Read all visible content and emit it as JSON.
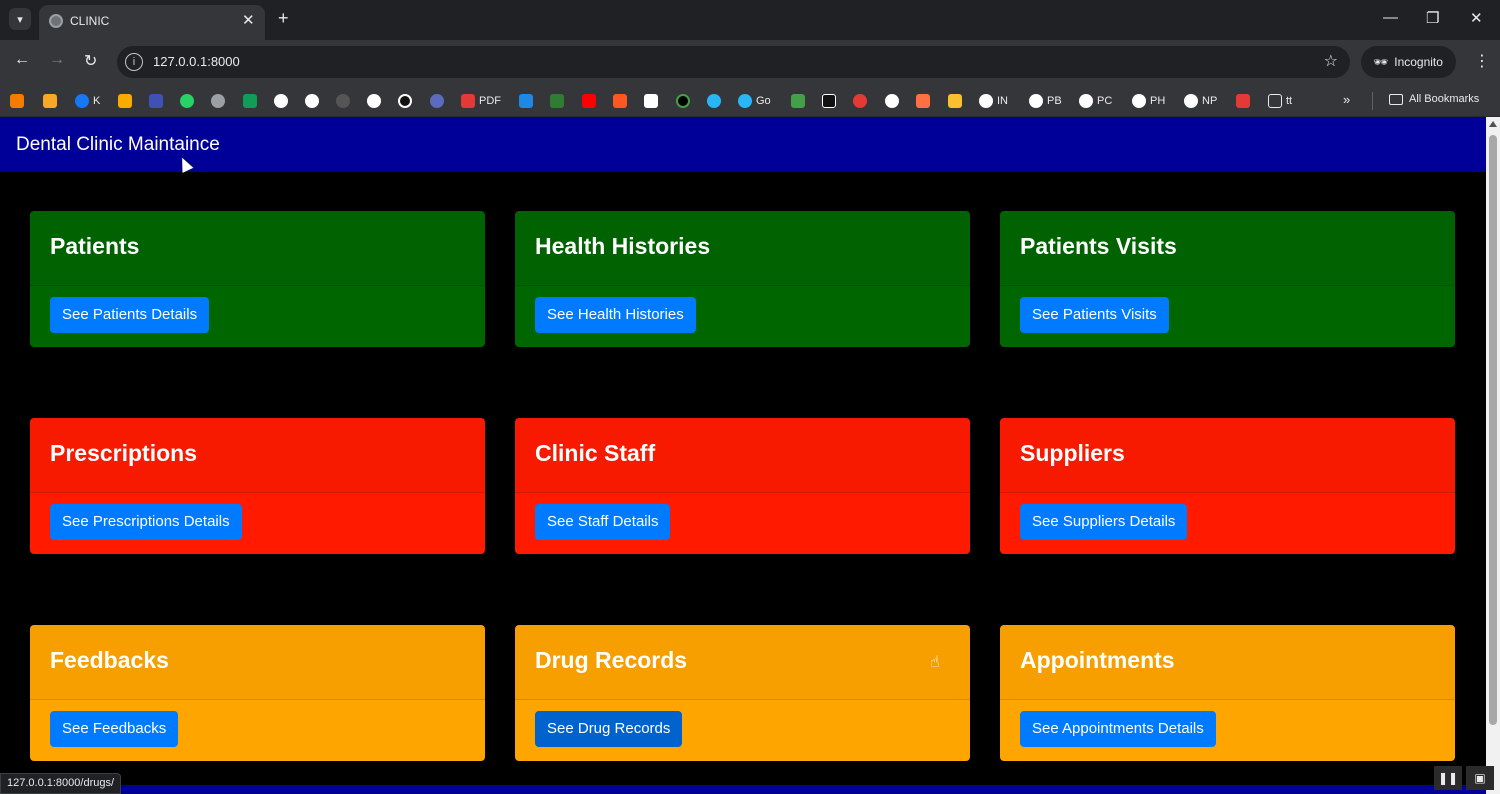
{
  "browser": {
    "tab_title": "CLINIC",
    "url": "127.0.0.1:8000",
    "incognito_label": "Incognito",
    "status_url": "127.0.0.1:8000/drugs/",
    "bookmarks": [
      {
        "label": "K",
        "color": "#1877f2"
      },
      {
        "label": "PDF",
        "color": "#e53935"
      },
      {
        "label": "Go",
        "color": "#29b6f6"
      },
      {
        "label": "IN",
        "color": "#ffffff"
      },
      {
        "label": "PB",
        "color": "#ffffff"
      },
      {
        "label": "PC",
        "color": "#ffffff"
      },
      {
        "label": "PH",
        "color": "#ffffff"
      },
      {
        "label": "NP",
        "color": "#ffffff"
      },
      {
        "label": "tt",
        "color": "#e8eaed"
      }
    ],
    "all_bookmarks_label": "All Bookmarks"
  },
  "navbar": {
    "brand": "Dental Clinic Maintaince"
  },
  "colors": {
    "navbar": "#000099",
    "green": "#006600",
    "red": "#ff1a00",
    "orange": "#ffa500",
    "button": "#007bff"
  },
  "cards": [
    {
      "title": "Patients",
      "button": "See Patients Details",
      "color": "green"
    },
    {
      "title": "Health Histories",
      "button": "See Health Histories",
      "color": "green"
    },
    {
      "title": "Patients Visits",
      "button": "See Patients Visits",
      "color": "green"
    },
    {
      "title": "Prescriptions",
      "button": "See Prescriptions Details",
      "color": "red"
    },
    {
      "title": "Clinic Staff",
      "button": "See Staff Details",
      "color": "red"
    },
    {
      "title": "Suppliers",
      "button": "See Suppliers Details",
      "color": "red"
    },
    {
      "title": "Feedbacks",
      "button": "See Feedbacks",
      "color": "orange"
    },
    {
      "title": "Drug Records",
      "button": "See Drug Records",
      "color": "orange"
    },
    {
      "title": "Appointments",
      "button": "See Appointments Details",
      "color": "orange"
    }
  ]
}
